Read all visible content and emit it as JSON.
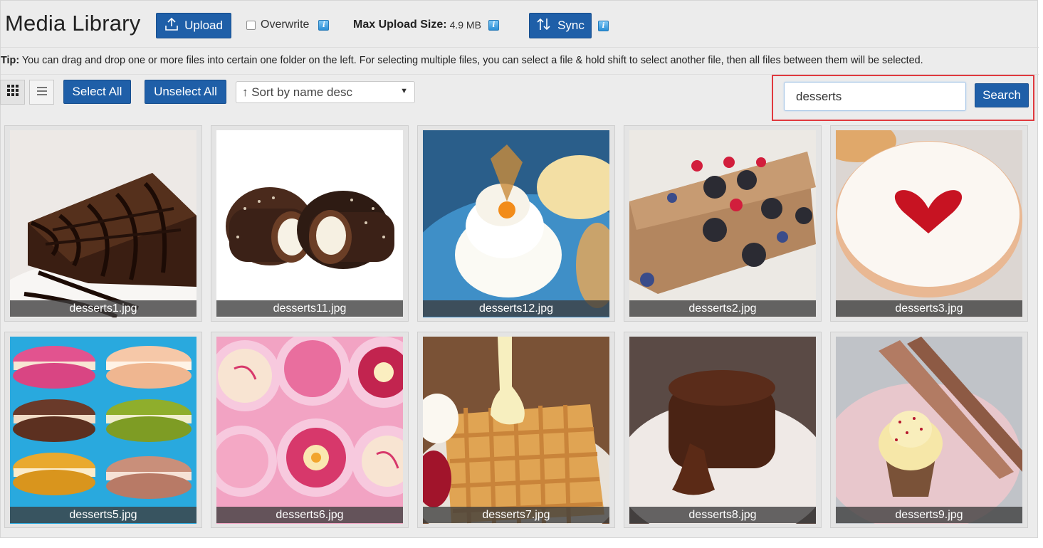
{
  "header": {
    "title": "Media Library",
    "upload_label": "Upload",
    "overwrite_label": "Overwrite",
    "max_upload_label": "Max Upload Size:",
    "max_upload_value": "4.9 MB",
    "sync_label": "Sync"
  },
  "tip": {
    "label": "Tip:",
    "text": " You can drag and drop one or more files into certain one folder on the left. For selecting multiple files, you can select a file & hold shift to select another file, then all files between them will be selected."
  },
  "toolbar": {
    "select_all_label": "Select All",
    "unselect_all_label": "Unselect All",
    "sort_value": "↑ Sort by name desc",
    "search_value": "desserts",
    "search_label": "Search"
  },
  "colors": {
    "primary": "#1f5fa8",
    "highlight_border": "#e0393e"
  },
  "files": [
    {
      "name": "desserts1.jpg",
      "thumb": "brownie"
    },
    {
      "name": "desserts11.jpg",
      "thumb": "coconut-roll"
    },
    {
      "name": "desserts12.jpg",
      "thumb": "cream-physalis"
    },
    {
      "name": "desserts2.jpg",
      "thumb": "waffle-berries"
    },
    {
      "name": "desserts3.jpg",
      "thumb": "heart-cookie"
    },
    {
      "name": "desserts5.jpg",
      "thumb": "macarons"
    },
    {
      "name": "desserts6.jpg",
      "thumb": "pink-petit-fours"
    },
    {
      "name": "desserts7.jpg",
      "thumb": "waffle-sauce"
    },
    {
      "name": "desserts8.jpg",
      "thumb": "lava-cake"
    },
    {
      "name": "desserts9.jpg",
      "thumb": "cupcake"
    }
  ]
}
